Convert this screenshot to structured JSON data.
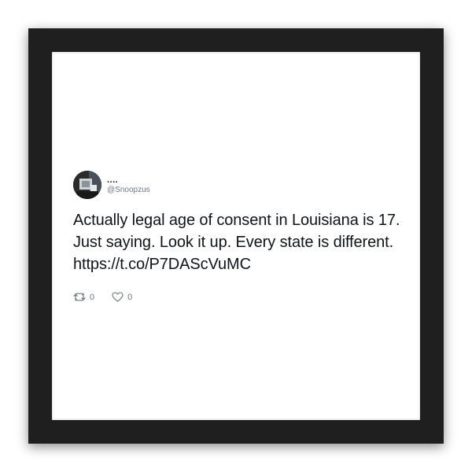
{
  "tweet": {
    "display_name": "....",
    "handle": "@Snoopzus",
    "text": "Actually legal age of consent in Louisiana is 17. Just saying. Look it up. Every state is different. https://t.co/P7DAScVuMC",
    "retweets": "0",
    "likes": "0",
    "avatar_icon": "profile-photo"
  },
  "colors": {
    "frame": "#1f1f1f",
    "mat": "#ffffff",
    "text": "#0f1419",
    "secondary": "#6b7783"
  },
  "icons": {
    "retweet": "retweet-icon",
    "like": "heart-icon"
  }
}
